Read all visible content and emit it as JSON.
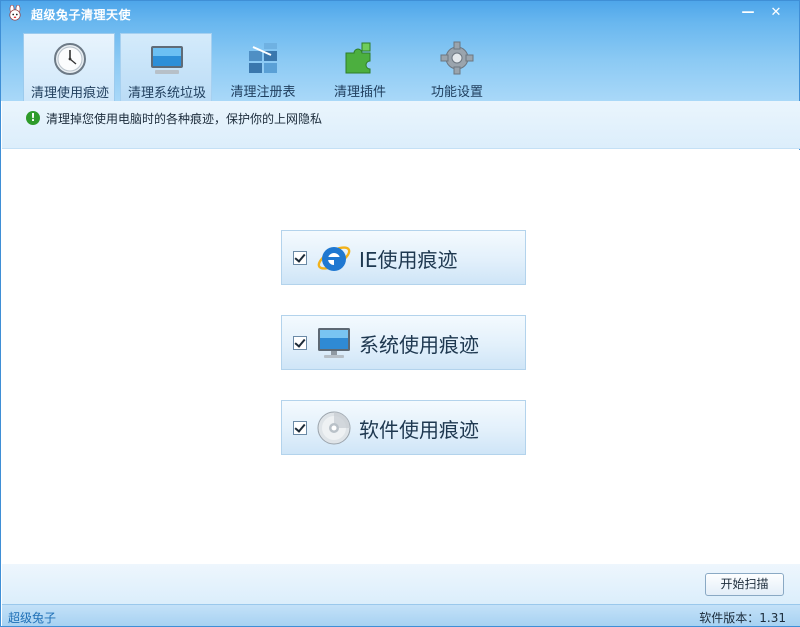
{
  "window": {
    "title": "超级兔子清理天使",
    "app_icon": "rabbit-logo-icon",
    "minimize_glyph": "—",
    "close_glyph": "✕"
  },
  "tabs": [
    {
      "label": "清理使用痕迹",
      "icon": "clock-icon",
      "state": "active"
    },
    {
      "label": "清理系统垃圾",
      "icon": "monitor-icon",
      "state": "hover"
    },
    {
      "label": "清理注册表",
      "icon": "registry-blocks-icon",
      "state": "normal"
    },
    {
      "label": "清理插件",
      "icon": "puzzle-icon",
      "state": "normal"
    },
    {
      "label": "功能设置",
      "icon": "gear-icon",
      "state": "normal"
    }
  ],
  "info": {
    "icon": "exclamation-icon",
    "glyph": "!",
    "text": "清理掉您使用电脑时的各种痕迹，保护你的上网隐私"
  },
  "options": [
    {
      "label": "IE使用痕迹",
      "icon": "ie-logo-icon",
      "checked": true
    },
    {
      "label": "系统使用痕迹",
      "icon": "computer-monitor-icon",
      "checked": true
    },
    {
      "label": "软件使用痕迹",
      "icon": "cd-disc-icon",
      "checked": true
    }
  ],
  "actions": {
    "scan_label": "开始扫描"
  },
  "status": {
    "left": "超级兔子",
    "version": "软件版本：1.31"
  },
  "colors": {
    "title_blue": "#4ea6ea",
    "status_link": "#1e6fb6",
    "info_green": "#2e9b2a"
  }
}
